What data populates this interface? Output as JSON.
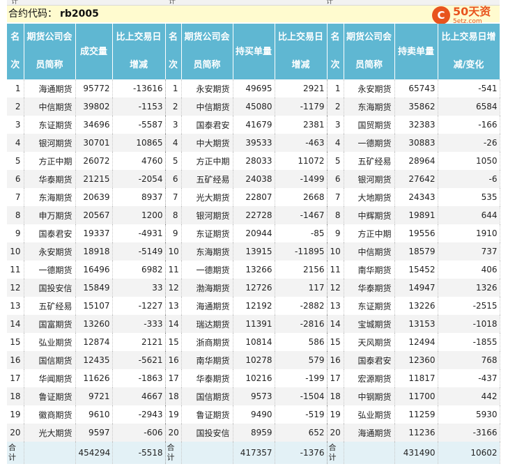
{
  "top_strip": [
    "计",
    "计",
    "计"
  ],
  "code": {
    "label": "合约代码：",
    "value": "rb2005"
  },
  "logo": {
    "badge": "C",
    "main": "50天资",
    "sub": "5etz.com"
  },
  "headers": {
    "rank": [
      "名",
      "次"
    ],
    "member": [
      "期货公司会",
      "员简称"
    ],
    "volume": "成交量",
    "change_day": [
      "比上交易日",
      "增减"
    ],
    "long_qty": "持买单量",
    "short_qty": "持卖单量",
    "change_day_3": [
      "比上交易日增",
      "减/变化"
    ]
  },
  "rows": [
    {
      "r": "1",
      "a": "海通期货",
      "av": "95772",
      "ad": "-13616",
      "b": "永安期货",
      "bv": "49695",
      "bd": "2921",
      "c": "永安期货",
      "cv": "65743",
      "cd": "-541"
    },
    {
      "r": "2",
      "a": "中信期货",
      "av": "39802",
      "ad": "-1153",
      "b": "中信期货",
      "bv": "45080",
      "bd": "-1179",
      "c": "东海期货",
      "cv": "35862",
      "cd": "6584"
    },
    {
      "r": "3",
      "a": "东证期货",
      "av": "34696",
      "ad": "-5587",
      "b": "国泰君安",
      "bv": "41679",
      "bd": "2381",
      "c": "国贸期货",
      "cv": "32383",
      "cd": "-166"
    },
    {
      "r": "4",
      "a": "银河期货",
      "av": "30701",
      "ad": "10865",
      "b": "中大期货",
      "bv": "39533",
      "bd": "-463",
      "c": "一德期货",
      "cv": "30883",
      "cd": "-26"
    },
    {
      "r": "5",
      "a": "方正中期",
      "av": "26072",
      "ad": "4760",
      "b": "方正中期",
      "bv": "28033",
      "bd": "11072",
      "c": "五矿经易",
      "cv": "28964",
      "cd": "1050"
    },
    {
      "r": "6",
      "a": "华泰期货",
      "av": "21215",
      "ad": "-2054",
      "b": "五矿经易",
      "bv": "24038",
      "bd": "-1499",
      "c": "银河期货",
      "cv": "27642",
      "cd": "-6"
    },
    {
      "r": "7",
      "a": "东海期货",
      "av": "20639",
      "ad": "8937",
      "b": "光大期货",
      "bv": "22807",
      "bd": "2668",
      "c": "大地期货",
      "cv": "24343",
      "cd": "535"
    },
    {
      "r": "8",
      "a": "申万期货",
      "av": "20567",
      "ad": "1200",
      "b": "银河期货",
      "bv": "22728",
      "bd": "-1467",
      "c": "中辉期货",
      "cv": "19891",
      "cd": "644"
    },
    {
      "r": "9",
      "a": "国泰君安",
      "av": "19337",
      "ad": "-4931",
      "b": "东证期货",
      "bv": "20944",
      "bd": "-85",
      "c": "方正中期",
      "cv": "19556",
      "cd": "1910"
    },
    {
      "r": "10",
      "a": "永安期货",
      "av": "18918",
      "ad": "-5149",
      "b": "东海期货",
      "bv": "13915",
      "bd": "-11895",
      "c": "中信期货",
      "cv": "18579",
      "cd": "737"
    },
    {
      "r": "11",
      "a": "一德期货",
      "av": "16496",
      "ad": "6982",
      "b": "一德期货",
      "bv": "13266",
      "bd": "2156",
      "c": "南华期货",
      "cv": "15452",
      "cd": "406"
    },
    {
      "r": "12",
      "a": "国投安信",
      "av": "15849",
      "ad": "33",
      "b": "渤海期货",
      "bv": "12726",
      "bd": "117",
      "c": "华泰期货",
      "cv": "14947",
      "cd": "1326"
    },
    {
      "r": "13",
      "a": "五矿经易",
      "av": "15107",
      "ad": "-1227",
      "b": "海通期货",
      "bv": "12192",
      "bd": "-2882",
      "c": "东证期货",
      "cv": "13226",
      "cd": "-2515"
    },
    {
      "r": "14",
      "a": "国富期货",
      "av": "13260",
      "ad": "-333",
      "b": "瑞达期货",
      "bv": "11391",
      "bd": "-2816",
      "c": "宝城期货",
      "cv": "13153",
      "cd": "-1018"
    },
    {
      "r": "15",
      "a": "弘业期货",
      "av": "12874",
      "ad": "2121",
      "b": "浙商期货",
      "bv": "10814",
      "bd": "586",
      "c": "天风期货",
      "cv": "12494",
      "cd": "-1855"
    },
    {
      "r": "16",
      "a": "国信期货",
      "av": "12435",
      "ad": "-5621",
      "b": "南华期货",
      "bv": "10278",
      "bd": "579",
      "c": "国泰君安",
      "cv": "12360",
      "cd": "768"
    },
    {
      "r": "17",
      "a": "华闻期货",
      "av": "11626",
      "ad": "-1863",
      "b": "华泰期货",
      "bv": "10216",
      "bd": "-199",
      "c": "宏源期货",
      "cv": "11817",
      "cd": "-437"
    },
    {
      "r": "18",
      "a": "鲁证期货",
      "av": "9721",
      "ad": "4667",
      "b": "国信期货",
      "bv": "9573",
      "bd": "-1504",
      "c": "中钢期货",
      "cv": "11700",
      "cd": "442"
    },
    {
      "r": "19",
      "a": "徽商期货",
      "av": "9610",
      "ad": "-2943",
      "b": "鲁证期货",
      "bv": "9490",
      "bd": "-519",
      "c": "弘业期货",
      "cv": "11259",
      "cd": "5930"
    },
    {
      "r": "20",
      "a": "光大期货",
      "av": "9597",
      "ad": "-606",
      "b": "国投安信",
      "bv": "8959",
      "bd": "652",
      "c": "海通期货",
      "cv": "11236",
      "cd": "-3166"
    }
  ],
  "totals": {
    "label": "合计",
    "av": "454294",
    "ad": "-5518",
    "bv": "417357",
    "bd": "-1376",
    "cv": "431490",
    "cd": "10602"
  }
}
